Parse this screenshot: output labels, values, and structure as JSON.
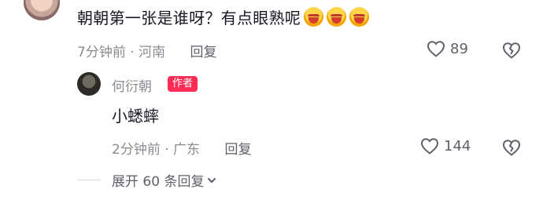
{
  "top_comment": {
    "text": "朝朝第一张是谁呀？有点眼熟呢",
    "emojis": [
      "angry-grin-emoji",
      "angry-grin-emoji",
      "angry-grin-emoji"
    ],
    "time": "7分钟前",
    "location": "河南",
    "reply_label": "回复",
    "likes": "89"
  },
  "reply": {
    "author": "何衍朝",
    "badge": "作者",
    "text": "小蟋蟀",
    "time": "2分钟前",
    "location": "广东",
    "reply_label": "回复",
    "likes": "144"
  },
  "expand": {
    "label": "展开 60 条回复"
  },
  "meta_separator": "·"
}
